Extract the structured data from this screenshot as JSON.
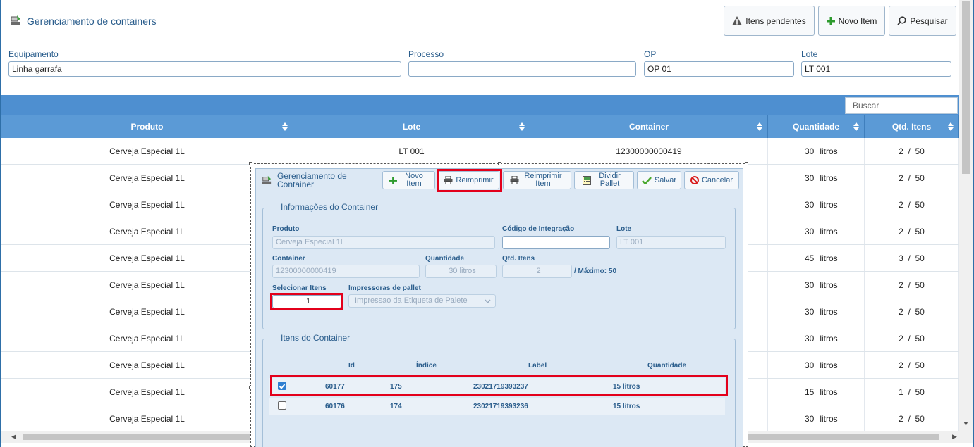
{
  "header": {
    "title": "Gerenciamento de containers",
    "buttons": {
      "pending": "Itens pendentes",
      "new_item": "Novo Item",
      "search": "Pesquisar"
    }
  },
  "filters": {
    "equipamento": {
      "label": "Equipamento",
      "value": "Linha garrafa"
    },
    "processo": {
      "label": "Processo",
      "value": ""
    },
    "op": {
      "label": "OP",
      "value": "OP 01"
    },
    "lote": {
      "label": "Lote",
      "value": "LT 001"
    }
  },
  "grid": {
    "search_placeholder": "Buscar",
    "columns": [
      "Produto",
      "Lote",
      "Container",
      "Quantidade",
      "Qtd. Itens"
    ],
    "rows": [
      {
        "produto": "Cerveja Especial 1L",
        "lote": "LT 001",
        "container": "12300000000419",
        "qtd": "30",
        "unit": "litros",
        "itens": "2  /  50"
      },
      {
        "produto": "Cerveja Especial 1L",
        "lote": "",
        "container": "",
        "qtd": "30",
        "unit": "litros",
        "itens": "2  /  50"
      },
      {
        "produto": "Cerveja Especial 1L",
        "lote": "",
        "container": "",
        "qtd": "30",
        "unit": "litros",
        "itens": "2  /  50"
      },
      {
        "produto": "Cerveja Especial 1L",
        "lote": "",
        "container": "",
        "qtd": "30",
        "unit": "litros",
        "itens": "2  /  50"
      },
      {
        "produto": "Cerveja Especial 1L",
        "lote": "",
        "container": "",
        "qtd": "45",
        "unit": "litros",
        "itens": "3  /  50"
      },
      {
        "produto": "Cerveja Especial 1L",
        "lote": "",
        "container": "",
        "qtd": "30",
        "unit": "litros",
        "itens": "2  /  50"
      },
      {
        "produto": "Cerveja Especial 1L",
        "lote": "",
        "container": "",
        "qtd": "30",
        "unit": "litros",
        "itens": "2  /  50"
      },
      {
        "produto": "Cerveja Especial 1L",
        "lote": "",
        "container": "",
        "qtd": "30",
        "unit": "litros",
        "itens": "2  /  50"
      },
      {
        "produto": "Cerveja Especial 1L",
        "lote": "",
        "container": "",
        "qtd": "30",
        "unit": "litros",
        "itens": "2  /  50"
      },
      {
        "produto": "Cerveja Especial 1L",
        "lote": "",
        "container": "",
        "qtd": "15",
        "unit": "litros",
        "itens": "1  /  50"
      },
      {
        "produto": "Cerveja Especial 1L",
        "lote": "",
        "container": "",
        "qtd": "30",
        "unit": "litros",
        "itens": "2  /  50"
      }
    ]
  },
  "modal": {
    "title": "Gerenciamento de Container",
    "buttons": {
      "novo_item": "Novo Item",
      "reimprimir": "Reimprimir",
      "reimprimir_item": "Reimprimir Item",
      "dividir_pallet": "Dividir Pallet",
      "salvar": "Salvar",
      "cancelar": "Cancelar"
    },
    "info": {
      "legend": "Informações do Container",
      "produto": {
        "label": "Produto",
        "value": "Cerveja Especial 1L"
      },
      "codigo": {
        "label": "Código de Integração",
        "value": ""
      },
      "lote": {
        "label": "Lote",
        "value": "LT 001"
      },
      "container": {
        "label": "Container",
        "value": "12300000000419"
      },
      "quantidade": {
        "label": "Quantidade",
        "value": "30 litros"
      },
      "qtd_itens": {
        "label": "Qtd. Itens",
        "value": "2",
        "max": "/ Máximo: 50"
      },
      "selecionar": {
        "label": "Selecionar Itens",
        "value": "1"
      },
      "impressoras": {
        "label": "Impressoras de pallet",
        "value": "Impressao da Etiqueta de Palete"
      }
    },
    "items": {
      "legend": "Itens do Container",
      "columns": [
        "Id",
        "Índice",
        "Label",
        "Quantidade"
      ],
      "rows": [
        {
          "checked": true,
          "id": "60177",
          "indice": "175",
          "label": "23021719393237",
          "quantidade": "15 litros"
        },
        {
          "checked": false,
          "id": "60176",
          "indice": "174",
          "label": "23021719393236",
          "quantidade": "15 litros"
        }
      ]
    }
  },
  "colors": {
    "accent": "#4e8fd0",
    "header_blue": "#5b9ad6",
    "highlight": "#e3001b"
  }
}
